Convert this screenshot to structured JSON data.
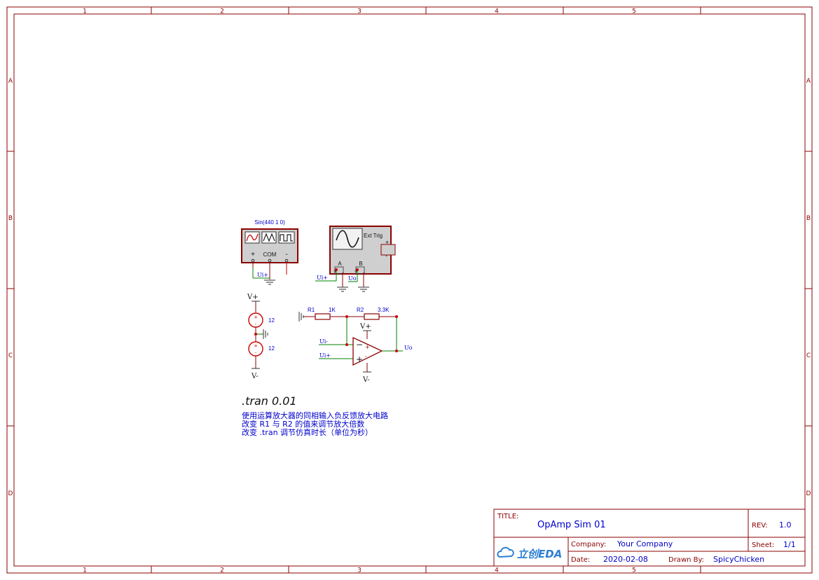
{
  "frame": {
    "col_labels": [
      "1",
      "2",
      "3",
      "4",
      "5"
    ],
    "row_labels": [
      "A",
      "B",
      "C",
      "D"
    ]
  },
  "generator": {
    "spec": "Sin(440 1 0)",
    "plus": "+",
    "com": "COM",
    "minus": "-"
  },
  "scope": {
    "ext_trig": "Ext Trig",
    "ch_a": "A",
    "ch_b": "B"
  },
  "supply": {
    "vplus": "V+",
    "vminus": "V-",
    "v1": "12",
    "v2": "12"
  },
  "resistors": {
    "r1_name": "R1",
    "r1_value": "1K",
    "r2_name": "R2",
    "r2_value": "3.3K"
  },
  "opamp": {
    "vplus": "V+",
    "vminus": "V-"
  },
  "nets": {
    "ui_plus_gen": "Ui+",
    "ui_plus_scope": "Ui+",
    "uo_scope": "Uo",
    "ui_minus": "Ui-",
    "ui_plus_amp": "Ui+",
    "uo": "Uo"
  },
  "notes": {
    "directive": ".tran 0.01",
    "line1": "使用运算放大器的同相输入负反馈放大电路",
    "line2": "改变 R1 与 R2 的值来调节放大倍数",
    "line3": "改变 .tran 调节仿真时长（单位为秒）"
  },
  "titleblock": {
    "title_label": "TITLE:",
    "title": "OpAmp Sim 01",
    "rev_label": "REV:",
    "rev": "1.0",
    "company_label": "Company:",
    "company": "Your Company",
    "sheet_label": "Sheet:",
    "sheet": "1/1",
    "date_label": "Date:",
    "date": "2020-02-08",
    "drawn_label": "Drawn By:",
    "drawn_by": "SpicyChicken",
    "logo": "立创EDA"
  },
  "colors": {
    "frame": "#8b0000",
    "wire": "#008000",
    "text": "#0000cc",
    "component_fill": "#cfcfcf",
    "junction": "#cc0000"
  }
}
